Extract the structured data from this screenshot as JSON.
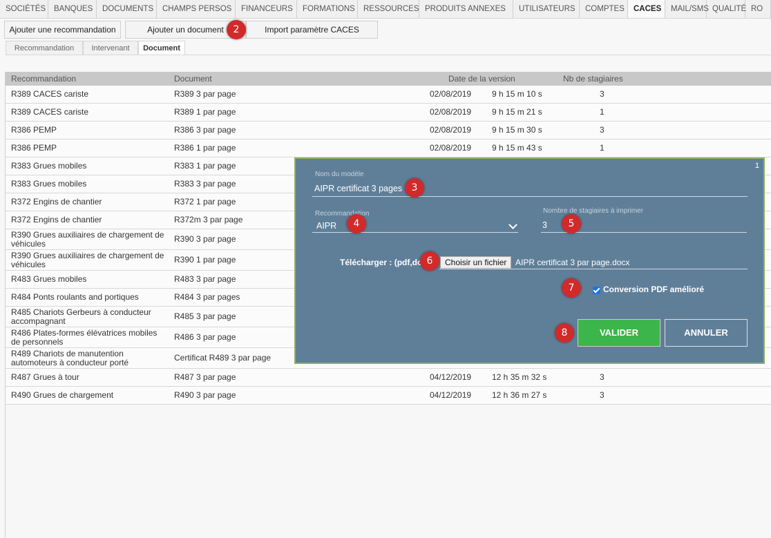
{
  "top_tabs": [
    "SOCIÉTÉS",
    "BANQUES",
    "DOCUMENTS",
    "CHAMPS PERSOS",
    "FINANCEURS",
    "FORMATIONS",
    "RESSOURCES",
    "PRODUITS ANNEXES",
    "UTILISATEURS",
    "COMPTES",
    "CACES",
    "MAIL/SMS",
    "QUALITÉ",
    "RO"
  ],
  "active_top_tab": "CACES",
  "actions": {
    "add_recommendation": "Ajouter une recommandation",
    "add_document": "Ajouter un document",
    "import_caces": "Import paramètre CACES"
  },
  "subtabs": [
    "Recommandation",
    "Intervenant",
    "Document"
  ],
  "active_subtab": "Document",
  "table": {
    "headers": [
      "Recommandation",
      "Document",
      "Date de la version",
      "Nb de stagiaires"
    ],
    "rows": [
      {
        "reco": "R389 CACES cariste",
        "doc": "R389 3 par page",
        "date": "02/08/2019",
        "time": "9 h 15 m 10 s",
        "nb": "3"
      },
      {
        "reco": "R389 CACES cariste",
        "doc": "R389 1 par page",
        "date": "02/08/2019",
        "time": "9 h 15 m 21 s",
        "nb": "1"
      },
      {
        "reco": "R386 PEMP",
        "doc": "R386 3 par page",
        "date": "02/08/2019",
        "time": "9 h 15 m 30 s",
        "nb": "3"
      },
      {
        "reco": "R386 PEMP",
        "doc": "R386 1 par page",
        "date": "02/08/2019",
        "time": "9 h 15 m 43 s",
        "nb": "1"
      },
      {
        "reco": "R383 Grues mobiles",
        "doc": "R383 1 par page",
        "date": "",
        "time": "",
        "nb": ""
      },
      {
        "reco": "R383 Grues mobiles",
        "doc": "R383 3 par page",
        "date": "",
        "time": "",
        "nb": ""
      },
      {
        "reco": "R372 Engins de chantier",
        "doc": "R372 1 par page",
        "date": "",
        "time": "",
        "nb": ""
      },
      {
        "reco": "R372 Engins de chantier",
        "doc": "R372m 3 par page",
        "date": "",
        "time": "",
        "nb": ""
      },
      {
        "reco": "R390 Grues auxiliaires de chargement de véhicules",
        "doc": "R390 3 par page",
        "date": "",
        "time": "",
        "nb": ""
      },
      {
        "reco": "R390 Grues auxiliaires de chargement de véhicules",
        "doc": "R390 1 par page",
        "date": "",
        "time": "",
        "nb": ""
      },
      {
        "reco": "R483 Grues mobiles",
        "doc": "R483 3 par page",
        "date": "",
        "time": "",
        "nb": ""
      },
      {
        "reco": "R484 Ponts roulants and portiques",
        "doc": "R484 3 par pages",
        "date": "",
        "time": "",
        "nb": ""
      },
      {
        "reco": "R485 Chariots Gerbeurs à conducteur accompagnant",
        "doc": "R485 3 par page",
        "date": "",
        "time": "",
        "nb": ""
      },
      {
        "reco": "R486 Plates-formes élévatrices mobiles de personnels",
        "doc": "R486 3 par page",
        "date": "",
        "time": "",
        "nb": ""
      },
      {
        "reco": "R489 Chariots de manutention automoteurs à conducteur porté",
        "doc": "Certificat R489 3 par page",
        "date": "",
        "time": "",
        "nb": ""
      },
      {
        "reco": "R487 Grues à tour",
        "doc": "R487 3 par page",
        "date": "04/12/2019",
        "time": "12 h 35 m 32 s",
        "nb": "3"
      },
      {
        "reco": "R490 Grues de chargement",
        "doc": "R490 3 par page",
        "date": "04/12/2019",
        "time": "12 h 36 m 27 s",
        "nb": "3"
      }
    ]
  },
  "modal": {
    "corner_number": "1",
    "model_name_label": "Nom du modèle",
    "model_name_value": "AIPR certificat 3 pages",
    "recommendation_label": "Recommandation",
    "recommendation_value": "AIPR",
    "trainees_label": "Nombre de stagiaires à imprimer",
    "trainees_value": "3",
    "upload_label": "Télécharger : (pdf,doc",
    "choose_file_button": "Choisir un fichier",
    "file_name": "AIPR certificat 3 par page.docx",
    "pdf_conversion_label": "Conversion PDF amélioré",
    "pdf_conversion_checked": true,
    "validate_button": "VALIDER",
    "cancel_button": "ANNULER"
  },
  "callouts": [
    "2",
    "3",
    "4",
    "5",
    "6",
    "7",
    "8"
  ],
  "colors": {
    "modal_bg": "#5f7f99",
    "modal_border": "#8fb05c",
    "validate_bg": "#3cb54a",
    "callout_bg": "#d12a2a",
    "header_bg": "#c8c8c8"
  }
}
